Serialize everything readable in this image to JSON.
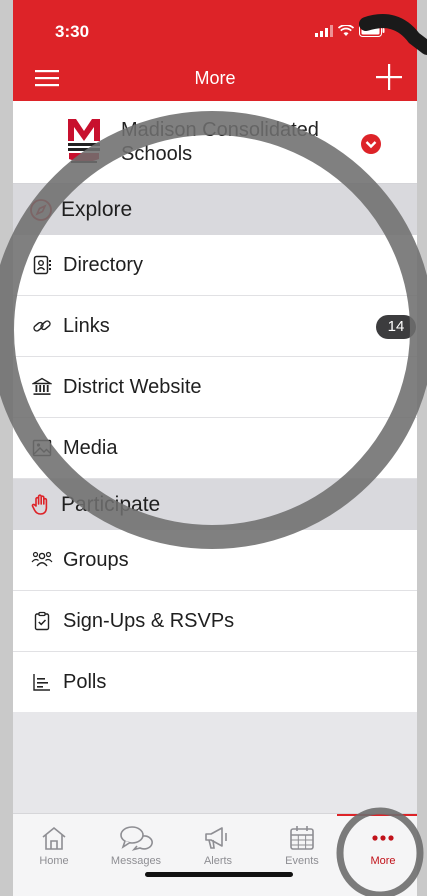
{
  "status": {
    "time": "3:30"
  },
  "header": {
    "title": "More"
  },
  "school": {
    "name": "Madison Consolidated Schools"
  },
  "sections": {
    "explore": {
      "label": "Explore",
      "items": [
        {
          "label": "Directory",
          "icon": "contact-book-icon"
        },
        {
          "label": "Links",
          "icon": "link-icon",
          "badge": "14"
        },
        {
          "label": "District Website",
          "icon": "institution-icon"
        },
        {
          "label": "Media",
          "icon": "image-icon"
        }
      ]
    },
    "participate": {
      "label": "Participate",
      "items": [
        {
          "label": "Groups",
          "icon": "people-icon"
        },
        {
          "label": "Sign-Ups & RSVPs",
          "icon": "clipboard-check-icon"
        },
        {
          "label": "Polls",
          "icon": "poll-icon"
        }
      ]
    }
  },
  "tabs": [
    {
      "label": "Home",
      "icon": "home-icon"
    },
    {
      "label": "Messages",
      "icon": "chat-bubbles-icon"
    },
    {
      "label": "Alerts",
      "icon": "megaphone-icon"
    },
    {
      "label": "Events",
      "icon": "calendar-icon"
    },
    {
      "label": "More",
      "icon": "dots-icon",
      "active": true
    }
  ],
  "colors": {
    "brand": "#dd2328",
    "section_bg": "#d9d9dd",
    "badge_bg": "#3c3c3e",
    "tab_inactive": "#8e8e93"
  }
}
